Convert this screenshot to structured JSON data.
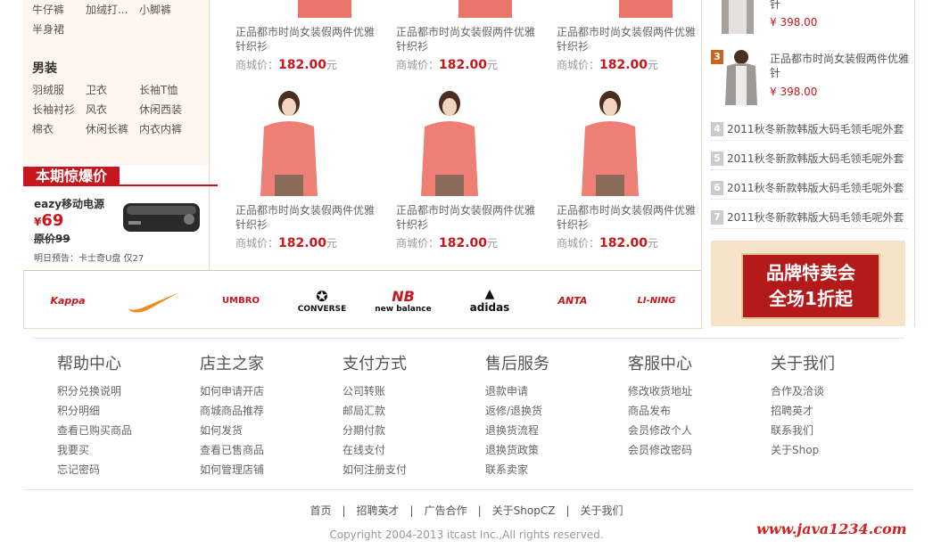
{
  "left": {
    "women_row1": [
      "牛仔裤",
      "加绒打...",
      "小脚裤"
    ],
    "women_row2": [
      "半身裙"
    ],
    "men_title": "男装",
    "men_rows": [
      [
        "羽绒服",
        "卫衣",
        "长袖T恤"
      ],
      [
        "长袖衬衫",
        "风衣",
        "休闲西装"
      ],
      [
        "棉衣",
        "休闲长裤",
        "内衣内裤"
      ]
    ],
    "promo": {
      "title": "本期惊爆价",
      "name": "eazy移动电源",
      "price_symbol": "¥",
      "price": "69",
      "orig": "原价99",
      "note": "明日预告：卡士奇U盘 仅27"
    }
  },
  "products_top": [
    {
      "name": "正品都市时尚女装假两件优雅针织衫",
      "price_label": "商城价：",
      "price": "182.00",
      "unit": "元"
    },
    {
      "name": "正品都市时尚女装假两件优雅针织衫",
      "price_label": "商城价：",
      "price": "182.00",
      "unit": "元"
    },
    {
      "name": "正品都市时尚女装假两件优雅针织衫",
      "price_label": "商城价：",
      "price": "182.00",
      "unit": "元"
    }
  ],
  "products_bottom": [
    {
      "name": "正品都市时尚女装假两件优雅针织衫",
      "price_label": "商城价：",
      "price": "182.00",
      "unit": "元"
    },
    {
      "name": "正品都市时尚女装假两件优雅针织衫",
      "price_label": "商城价：",
      "price": "182.00",
      "unit": "元"
    },
    {
      "name": "正品都市时尚女装假两件优雅针织衫",
      "price_label": "商城价：",
      "price": "182.00",
      "unit": "元"
    }
  ],
  "brands": [
    "Kappa",
    "nike-swoosh",
    "UMBRO",
    "CONVERSE",
    "new balance",
    "adidas",
    "ANTA",
    "LI-NING"
  ],
  "right": {
    "top_item": {
      "name_tail": "针",
      "price": "¥ 398.00"
    },
    "item3": {
      "rank": "3",
      "name": "正品都市时尚女装假两件优雅针",
      "price": "¥ 398.00"
    },
    "ranks": [
      {
        "num": "4",
        "text": "2011秋冬新款韩版大码毛领毛呢外套"
      },
      {
        "num": "5",
        "text": "2011秋冬新款韩版大码毛领毛呢外套"
      },
      {
        "num": "6",
        "text": "2011秋冬新款韩版大码毛领毛呢外套"
      },
      {
        "num": "7",
        "text": "2011秋冬新款韩版大码毛领毛呢外套"
      }
    ],
    "brandsale_line1": "品牌特卖会",
    "brandsale_line2": "全场1折起"
  },
  "help": [
    {
      "title": "帮助中心",
      "links": [
        "积分兑换说明",
        "积分明细",
        "查看已购买商品",
        "我要买",
        "忘记密码"
      ]
    },
    {
      "title": "店主之家",
      "links": [
        "如何申请开店",
        "商城商品推荐",
        "如何发货",
        "查看已售商品",
        "如何管理店铺"
      ]
    },
    {
      "title": "支付方式",
      "links": [
        "公司转账",
        "邮局汇款",
        "分期付款",
        "在线支付",
        "如何注册支付"
      ]
    },
    {
      "title": "售后服务",
      "links": [
        "退款申请",
        "返修/退换货",
        "退换货流程",
        "退换货政策",
        "联系卖家"
      ]
    },
    {
      "title": "客服中心",
      "links": [
        "修改收货地址",
        "商品发布",
        "会员修改个人",
        "会员修改密码"
      ]
    },
    {
      "title": "关于我们",
      "links": [
        "合作及洽谈",
        "招聘英才",
        "联系我们",
        "关于Shop"
      ]
    }
  ],
  "bottom_nav": [
    "首页",
    "招聘英才",
    "广告合作",
    "关于ShopCZ",
    "关于我们"
  ],
  "copyright": "Copyright 2004-2013 itcast Inc.,All rights reserved.",
  "watermark": "www.java1234.com",
  "colors": {
    "accent": "#c8161d",
    "panel_bg": "#fff7ef",
    "border": "#e8dcc8"
  }
}
